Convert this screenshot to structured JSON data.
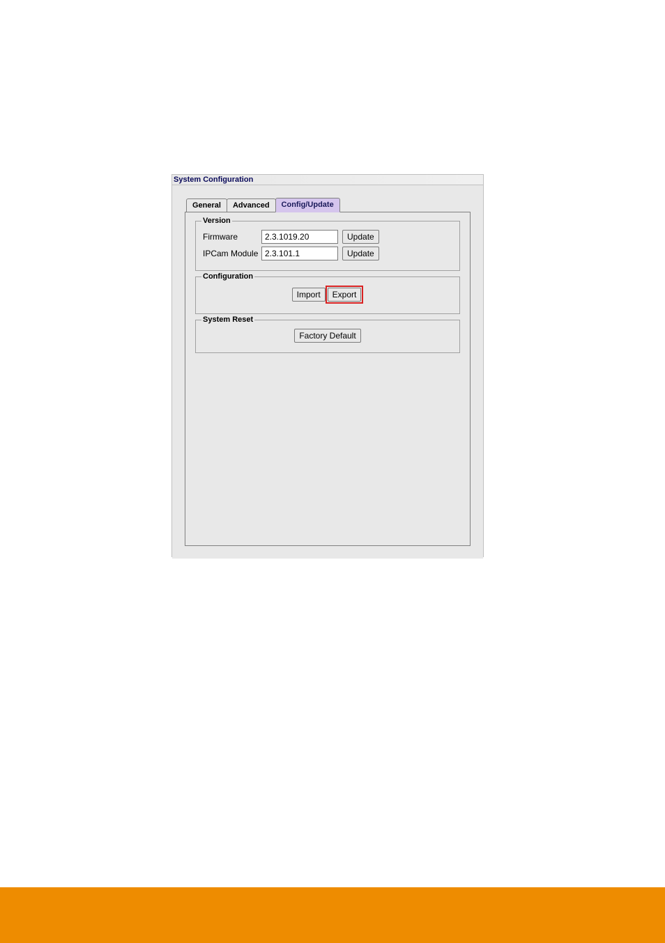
{
  "dialog": {
    "title": "System Configuration",
    "tabs": [
      {
        "label": "General"
      },
      {
        "label": "Advanced"
      },
      {
        "label": "Config/Update"
      }
    ]
  },
  "version": {
    "legend": "Version",
    "firmware_label": "Firmware",
    "firmware_value": "2.3.1019.20",
    "firmware_update": "Update",
    "ipcam_label": "IPCam Module",
    "ipcam_value": "2.3.101.1",
    "ipcam_update": "Update"
  },
  "configuration": {
    "legend": "Configuration",
    "import": "Import",
    "export": "Export"
  },
  "system_reset": {
    "legend": "System Reset",
    "factory_default": "Factory Default"
  }
}
